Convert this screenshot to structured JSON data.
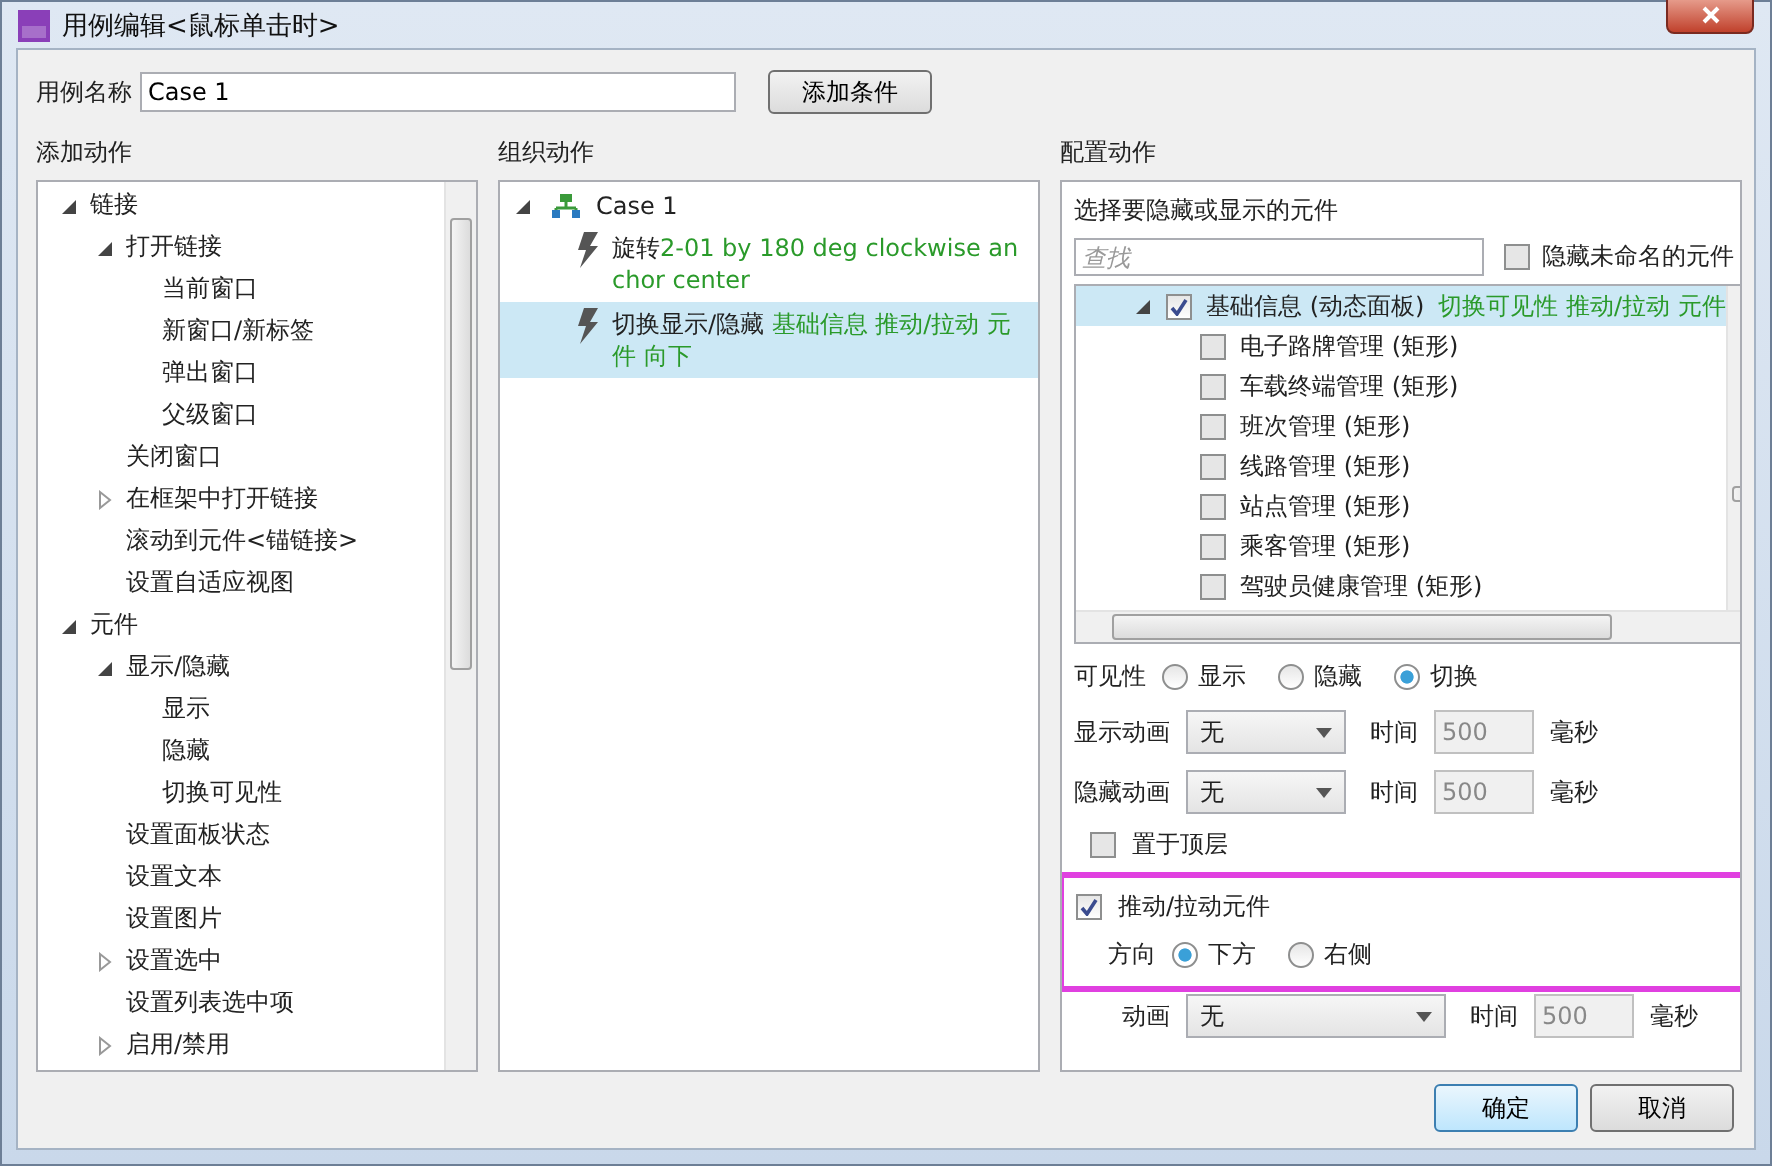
{
  "window": {
    "title": "用例编辑<鼠标单击时>"
  },
  "case_name": {
    "label": "用例名称",
    "value": "Case 1"
  },
  "add_condition_button": "添加条件",
  "add_actions": {
    "heading": "添加动作",
    "tree": [
      {
        "label": "链接",
        "expanded": true,
        "children": [
          {
            "label": "打开链接",
            "expanded": true,
            "children": [
              {
                "label": "当前窗口"
              },
              {
                "label": "新窗口/新标签"
              },
              {
                "label": "弹出窗口"
              },
              {
                "label": "父级窗口"
              }
            ]
          },
          {
            "label": "关闭窗口"
          },
          {
            "label": "在框架中打开链接",
            "expanded": false
          },
          {
            "label": "滚动到元件<锚链接>"
          },
          {
            "label": "设置自适应视图"
          }
        ]
      },
      {
        "label": "元件",
        "expanded": true,
        "children": [
          {
            "label": "显示/隐藏",
            "expanded": true,
            "children": [
              {
                "label": "显示"
              },
              {
                "label": "隐藏"
              },
              {
                "label": "切换可见性"
              }
            ]
          },
          {
            "label": "设置面板状态"
          },
          {
            "label": "设置文本"
          },
          {
            "label": "设置图片"
          },
          {
            "label": "设置选中",
            "expanded": false
          },
          {
            "label": "设置列表选中项"
          },
          {
            "label": "启用/禁用",
            "expanded": false
          }
        ]
      }
    ]
  },
  "organize_actions": {
    "heading": "组织动作",
    "case": {
      "label": "Case 1",
      "expanded": true
    },
    "actions": [
      {
        "name": "旋转",
        "detail": "2-01 by 180 deg clockwise anchor center",
        "selected": false
      },
      {
        "name": "切换显示/隐藏",
        "detail": " 基础信息 推动/拉动 元件 向下",
        "selected": true
      }
    ]
  },
  "configure": {
    "heading": "配置动作",
    "subtitle": "选择要隐藏或显示的元件",
    "search": {
      "placeholder": "查找"
    },
    "hide_unnamed": {
      "label": "隐藏未命名的元件",
      "checked": false
    },
    "widgets": [
      {
        "label": "基础信息 (动态面板)",
        "status": "切换可见性 推动/拉动 元件",
        "checked": true,
        "expanded": true,
        "selected": true,
        "children": [
          {
            "label": "电子路牌管理 (矩形)",
            "checked": false
          },
          {
            "label": "车载终端管理 (矩形)",
            "checked": false
          },
          {
            "label": "班次管理 (矩形)",
            "checked": false
          },
          {
            "label": "线路管理 (矩形)",
            "checked": false
          },
          {
            "label": "站点管理 (矩形)",
            "checked": false
          },
          {
            "label": "乘客管理 (矩形)",
            "checked": false
          },
          {
            "label": "驾驶员健康管理 (矩形)",
            "checked": false
          }
        ]
      }
    ],
    "visibility": {
      "label": "可见性",
      "options": [
        {
          "label": "显示",
          "selected": false
        },
        {
          "label": "隐藏",
          "selected": false
        },
        {
          "label": "切换",
          "selected": true
        }
      ]
    },
    "show_animation": {
      "label": "显示动画",
      "value": "无",
      "time_label": "时间",
      "time": "500",
      "unit": "毫秒"
    },
    "hide_animation": {
      "label": "隐藏动画",
      "value": "无",
      "time_label": "时间",
      "time": "500",
      "unit": "毫秒"
    },
    "bring_to_front": {
      "label": "置于顶层",
      "checked": false
    },
    "push_pull": {
      "label": "推动/拉动元件",
      "checked": true,
      "direction_label": "方向",
      "options": [
        {
          "label": "下方",
          "selected": true
        },
        {
          "label": "右侧",
          "selected": false
        }
      ],
      "animation": {
        "label": "动画",
        "value": "无",
        "time_label": "时间",
        "time": "500",
        "unit": "毫秒"
      }
    }
  },
  "buttons": [
    {
      "label": "确定",
      "kind": "primary"
    },
    {
      "label": "取消",
      "kind": "normal"
    }
  ]
}
